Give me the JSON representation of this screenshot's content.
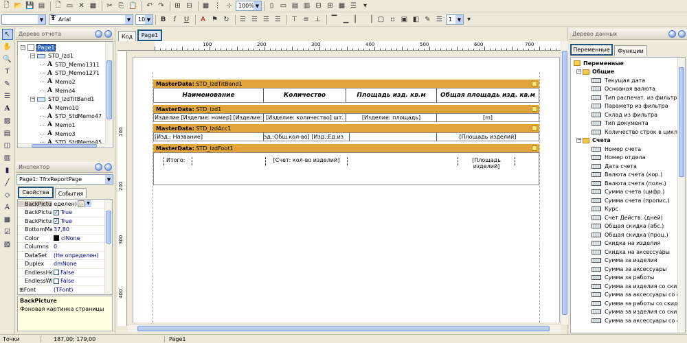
{
  "toolbar1": {
    "zoom": "100%"
  },
  "toolbar2": {
    "style_combo": "",
    "font_name": "Arial",
    "font_size": "10",
    "bold": "B",
    "italic": "I",
    "underline": "U",
    "frame_width": "1"
  },
  "report_tree": {
    "title": "Дерево отчета",
    "items": [
      {
        "label": "Page1",
        "level": 0,
        "kind": "page"
      },
      {
        "label": "STD_Izd1",
        "level": 1,
        "kind": "band"
      },
      {
        "label": "STD_Memo1311",
        "level": 2,
        "kind": "memo"
      },
      {
        "label": "STD_Memo1271",
        "level": 2,
        "kind": "memo"
      },
      {
        "label": "Memo2",
        "level": 2,
        "kind": "memo"
      },
      {
        "label": "Memo4",
        "level": 2,
        "kind": "memo"
      },
      {
        "label": "STD_IzdTitBand1",
        "level": 1,
        "kind": "band"
      },
      {
        "label": "Memo10",
        "level": 2,
        "kind": "memo"
      },
      {
        "label": "STD_StdMemo47",
        "level": 2,
        "kind": "memo"
      },
      {
        "label": "Memo1",
        "level": 2,
        "kind": "memo"
      },
      {
        "label": "Memo3",
        "level": 2,
        "kind": "memo"
      },
      {
        "label": "STD_StdMemo45",
        "level": 2,
        "kind": "memo"
      }
    ]
  },
  "inspector": {
    "title": "Инспектор",
    "object": "Page1: TfrxReportPage",
    "tabs": [
      "Свойства",
      "События"
    ],
    "properties": [
      {
        "name": "BackPicture",
        "value": "(Не определен)",
        "type": "text"
      },
      {
        "name": "BackPicturePrintable",
        "value": "True",
        "type": "check"
      },
      {
        "name": "BackPictureVisible",
        "value": "True",
        "type": "check"
      },
      {
        "name": "BottomMargin",
        "value": "37,80",
        "type": "text"
      },
      {
        "name": "Color",
        "value": "clNone",
        "type": "color"
      },
      {
        "name": "Columns",
        "value": "0",
        "type": "text"
      },
      {
        "name": "DataSet",
        "value": "(Не определен)",
        "type": "text"
      },
      {
        "name": "Duplex",
        "value": "dmNone",
        "type": "text"
      },
      {
        "name": "EndlessHeight",
        "value": "False",
        "type": "check"
      },
      {
        "name": "EndlessWidth",
        "value": "False",
        "type": "check"
      },
      {
        "name": "Font",
        "value": "(TFont)",
        "type": "text"
      }
    ],
    "hint_title": "BackPicture",
    "hint_text": "Фоновая картинка страницы"
  },
  "designer": {
    "tabs": [
      "Код",
      "Page1"
    ],
    "ruler_h": [
      "100",
      "200",
      "300",
      "400",
      "500",
      "600",
      "700"
    ],
    "ruler_v": [
      "100",
      "200",
      "300",
      "400"
    ],
    "bands": [
      {
        "title_prefix": "MasterData:",
        "title_name": "STD_IzdTitBand1",
        "cells": [
          "Наименование",
          "Количество",
          "Площадь изд. кв.м",
          "Общая площадь изд. кв.м"
        ]
      },
      {
        "title_prefix": "MasterData:",
        "title_name": "STD_Izd1",
        "cells": [
          "Изделие [Изделие: номер] [Изделие: ши",
          "[Изделие: количество] шт.",
          "[Изделие: площадь]",
          "[m]"
        ]
      },
      {
        "title_prefix": "MasterData:",
        "title_name": "STD_IzdAcc1",
        "cells": [
          "[Изд.: Название]",
          "зд.:Общ.кол-во] [Изд.:Ед.из",
          "",
          "[Площадь изделий]"
        ]
      },
      {
        "title_prefix": "MasterData:",
        "title_name": "STD_IzdFoot1",
        "cells": [
          "Итого:",
          "[Счет: кол-во изделий]",
          "[Площадь изделий]"
        ]
      }
    ]
  },
  "data_tree": {
    "title": "Дерево данных",
    "tabs": [
      "Переменные",
      "Функции"
    ],
    "root": "Переменные",
    "groups": [
      {
        "label": "Общие",
        "items": [
          "Текущая дата",
          "Основная валюта",
          "Тип распечат. из фильтра",
          "Параметр из фильтра",
          "Склад из фильтра",
          "Тип документа",
          "Количество строк в цикле"
        ]
      },
      {
        "label": "Счета",
        "items": [
          "Номер счета",
          "Номер отдела",
          "Дата счета",
          "Валюта счета (кор.)",
          "Валюта счета (полн.)",
          "Сумма счета (цифр.)",
          "Сумма счета (пропис.)",
          "Курс",
          "Счет Действ. (дней)",
          "Общая скидка (абс.)",
          "Общая скидка (проц.)",
          "Скидка на изделия",
          "Скидка на аксессуары",
          "Сумма за изделия",
          "Сумма за аксессуары",
          "Сумма за работы",
          "Сумма за изделия со скид",
          "Сумма за аксессуары со ски",
          "Сумма за работы со скид",
          "Сумма за изделия со скид",
          "Сумма за аксессуары со ски"
        ]
      }
    ]
  },
  "status": {
    "units": "Точки",
    "coords": "187,00; 179,00",
    "page": "Page1"
  },
  "colors": {
    "band_header": "#e0a43a",
    "tab_active_border": "#1c5180",
    "panel_bg": "#ece9d8"
  }
}
